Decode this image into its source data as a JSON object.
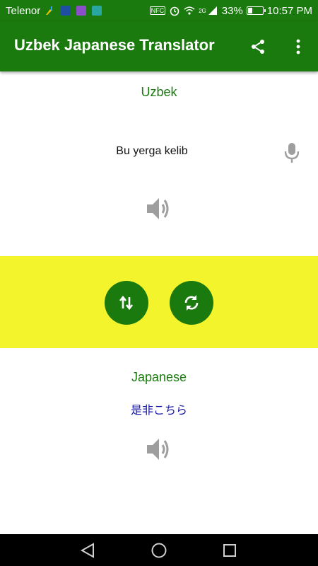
{
  "status_bar": {
    "carrier": "Telenor",
    "network": "2G",
    "battery": "33%",
    "battery_level": 0.33,
    "time": "10:57 PM",
    "nfc": "NFC"
  },
  "app_bar": {
    "title": "Uzbek Japanese Translator",
    "share_icon": "share-icon",
    "menu_icon": "more-vert-icon"
  },
  "source": {
    "language": "Uzbek",
    "text": "Bu yerga kelib",
    "mic_icon": "microphone-icon",
    "speaker_icon": "speaker-icon"
  },
  "actions": {
    "swap_icon": "swap-vertical-icon",
    "refresh_icon": "refresh-icon",
    "band_color": "#f4f42c",
    "button_color": "#1a7a0e"
  },
  "target": {
    "language": "Japanese",
    "text": "是非こちら",
    "speaker_icon": "speaker-icon"
  },
  "colors": {
    "primary": "#1a7a0e",
    "target_text": "#1a1aa8",
    "icon_gray": "#9e9e9e"
  }
}
